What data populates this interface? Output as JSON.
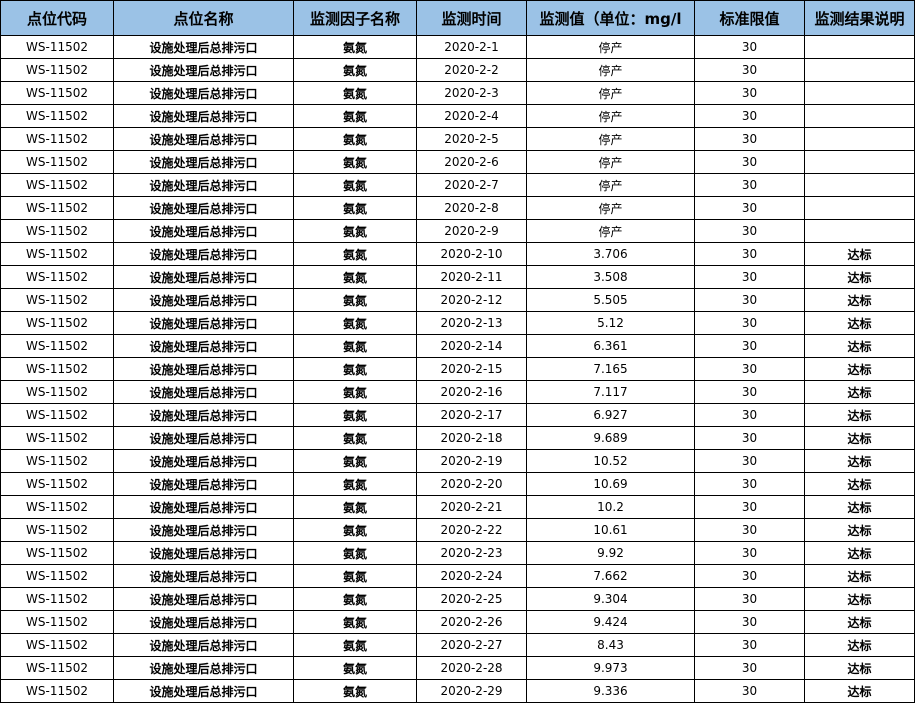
{
  "headers": [
    "点位代码",
    "点位名称",
    "监测因子名称",
    "监测时间",
    "监测值（单位：mg/l",
    "标准限值",
    "监测结果说明"
  ],
  "rows": [
    {
      "code": "WS-11502",
      "name": "设施处理后总排污口",
      "factor": "氨氮",
      "date": "2020-2-1",
      "value": "停产",
      "limit": "30",
      "result": ""
    },
    {
      "code": "WS-11502",
      "name": "设施处理后总排污口",
      "factor": "氨氮",
      "date": "2020-2-2",
      "value": "停产",
      "limit": "30",
      "result": ""
    },
    {
      "code": "WS-11502",
      "name": "设施处理后总排污口",
      "factor": "氨氮",
      "date": "2020-2-3",
      "value": "停产",
      "limit": "30",
      "result": ""
    },
    {
      "code": "WS-11502",
      "name": "设施处理后总排污口",
      "factor": "氨氮",
      "date": "2020-2-4",
      "value": "停产",
      "limit": "30",
      "result": ""
    },
    {
      "code": "WS-11502",
      "name": "设施处理后总排污口",
      "factor": "氨氮",
      "date": "2020-2-5",
      "value": "停产",
      "limit": "30",
      "result": ""
    },
    {
      "code": "WS-11502",
      "name": "设施处理后总排污口",
      "factor": "氨氮",
      "date": "2020-2-6",
      "value": "停产",
      "limit": "30",
      "result": ""
    },
    {
      "code": "WS-11502",
      "name": "设施处理后总排污口",
      "factor": "氨氮",
      "date": "2020-2-7",
      "value": "停产",
      "limit": "30",
      "result": ""
    },
    {
      "code": "WS-11502",
      "name": "设施处理后总排污口",
      "factor": "氨氮",
      "date": "2020-2-8",
      "value": "停产",
      "limit": "30",
      "result": ""
    },
    {
      "code": "WS-11502",
      "name": "设施处理后总排污口",
      "factor": "氨氮",
      "date": "2020-2-9",
      "value": "停产",
      "limit": "30",
      "result": ""
    },
    {
      "code": "WS-11502",
      "name": "设施处理后总排污口",
      "factor": "氨氮",
      "date": "2020-2-10",
      "value": "3.706",
      "limit": "30",
      "result": "达标"
    },
    {
      "code": "WS-11502",
      "name": "设施处理后总排污口",
      "factor": "氨氮",
      "date": "2020-2-11",
      "value": "3.508",
      "limit": "30",
      "result": "达标"
    },
    {
      "code": "WS-11502",
      "name": "设施处理后总排污口",
      "factor": "氨氮",
      "date": "2020-2-12",
      "value": "5.505",
      "limit": "30",
      "result": "达标"
    },
    {
      "code": "WS-11502",
      "name": "设施处理后总排污口",
      "factor": "氨氮",
      "date": "2020-2-13",
      "value": "5.12",
      "limit": "30",
      "result": "达标"
    },
    {
      "code": "WS-11502",
      "name": "设施处理后总排污口",
      "factor": "氨氮",
      "date": "2020-2-14",
      "value": "6.361",
      "limit": "30",
      "result": "达标"
    },
    {
      "code": "WS-11502",
      "name": "设施处理后总排污口",
      "factor": "氨氮",
      "date": "2020-2-15",
      "value": "7.165",
      "limit": "30",
      "result": "达标"
    },
    {
      "code": "WS-11502",
      "name": "设施处理后总排污口",
      "factor": "氨氮",
      "date": "2020-2-16",
      "value": "7.117",
      "limit": "30",
      "result": "达标"
    },
    {
      "code": "WS-11502",
      "name": "设施处理后总排污口",
      "factor": "氨氮",
      "date": "2020-2-17",
      "value": "6.927",
      "limit": "30",
      "result": "达标"
    },
    {
      "code": "WS-11502",
      "name": "设施处理后总排污口",
      "factor": "氨氮",
      "date": "2020-2-18",
      "value": "9.689",
      "limit": "30",
      "result": "达标"
    },
    {
      "code": "WS-11502",
      "name": "设施处理后总排污口",
      "factor": "氨氮",
      "date": "2020-2-19",
      "value": "10.52",
      "limit": "30",
      "result": "达标"
    },
    {
      "code": "WS-11502",
      "name": "设施处理后总排污口",
      "factor": "氨氮",
      "date": "2020-2-20",
      "value": "10.69",
      "limit": "30",
      "result": "达标"
    },
    {
      "code": "WS-11502",
      "name": "设施处理后总排污口",
      "factor": "氨氮",
      "date": "2020-2-21",
      "value": "10.2",
      "limit": "30",
      "result": "达标"
    },
    {
      "code": "WS-11502",
      "name": "设施处理后总排污口",
      "factor": "氨氮",
      "date": "2020-2-22",
      "value": "10.61",
      "limit": "30",
      "result": "达标"
    },
    {
      "code": "WS-11502",
      "name": "设施处理后总排污口",
      "factor": "氨氮",
      "date": "2020-2-23",
      "value": "9.92",
      "limit": "30",
      "result": "达标"
    },
    {
      "code": "WS-11502",
      "name": "设施处理后总排污口",
      "factor": "氨氮",
      "date": "2020-2-24",
      "value": "7.662",
      "limit": "30",
      "result": "达标"
    },
    {
      "code": "WS-11502",
      "name": "设施处理后总排污口",
      "factor": "氨氮",
      "date": "2020-2-25",
      "value": "9.304",
      "limit": "30",
      "result": "达标"
    },
    {
      "code": "WS-11502",
      "name": "设施处理后总排污口",
      "factor": "氨氮",
      "date": "2020-2-26",
      "value": "9.424",
      "limit": "30",
      "result": "达标"
    },
    {
      "code": "WS-11502",
      "name": "设施处理后总排污口",
      "factor": "氨氮",
      "date": "2020-2-27",
      "value": "8.43",
      "limit": "30",
      "result": "达标"
    },
    {
      "code": "WS-11502",
      "name": "设施处理后总排污口",
      "factor": "氨氮",
      "date": "2020-2-28",
      "value": "9.973",
      "limit": "30",
      "result": "达标"
    },
    {
      "code": "WS-11502",
      "name": "设施处理后总排污口",
      "factor": "氨氮",
      "date": "2020-2-29",
      "value": "9.336",
      "limit": "30",
      "result": "达标"
    }
  ],
  "colors": {
    "header_bg": "#9bc2e6",
    "border": "#000000"
  }
}
